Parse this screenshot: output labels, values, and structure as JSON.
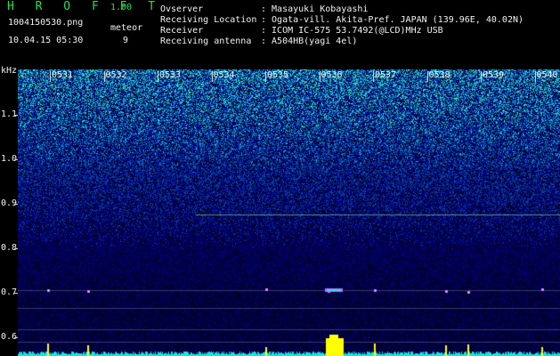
{
  "app": {
    "brand": "H R O F F T",
    "version": "1.00"
  },
  "file": {
    "name": "1004150530.png",
    "timestamp": "10.04.15 05:30"
  },
  "meteor": {
    "label": "meteor",
    "count": "9"
  },
  "info": {
    "observer_label": "Ovserver",
    "observer_value": ": Masayuki Kobayashi",
    "location_label": "Receiving Location",
    "location_value": ": Ogata-vill. Akita-Pref. JAPAN (139.96E, 40.02N)",
    "receiver_label": "Receiver",
    "receiver_value": ": ICOM IC-575 53.7492(@LCD)MHz USB",
    "antenna_label": "Receiving antenna",
    "antenna_value": ": A504HB(yagi 4el)"
  },
  "axis": {
    "unit": "kHz",
    "y_ticks": [
      "1.1",
      "1.0",
      "0.9",
      "0.8",
      "0.7",
      "0.6"
    ],
    "time_ticks": [
      "0531",
      "0532",
      "0533",
      "0534",
      "0535",
      "0536",
      "0537",
      "0538",
      "0539",
      "0540"
    ]
  },
  "colors": {
    "background": "#000000",
    "text": "#f2f2f2",
    "brand": "#22e04a",
    "signal": "#ffff00",
    "noise_floor": "#1de0e0"
  }
}
